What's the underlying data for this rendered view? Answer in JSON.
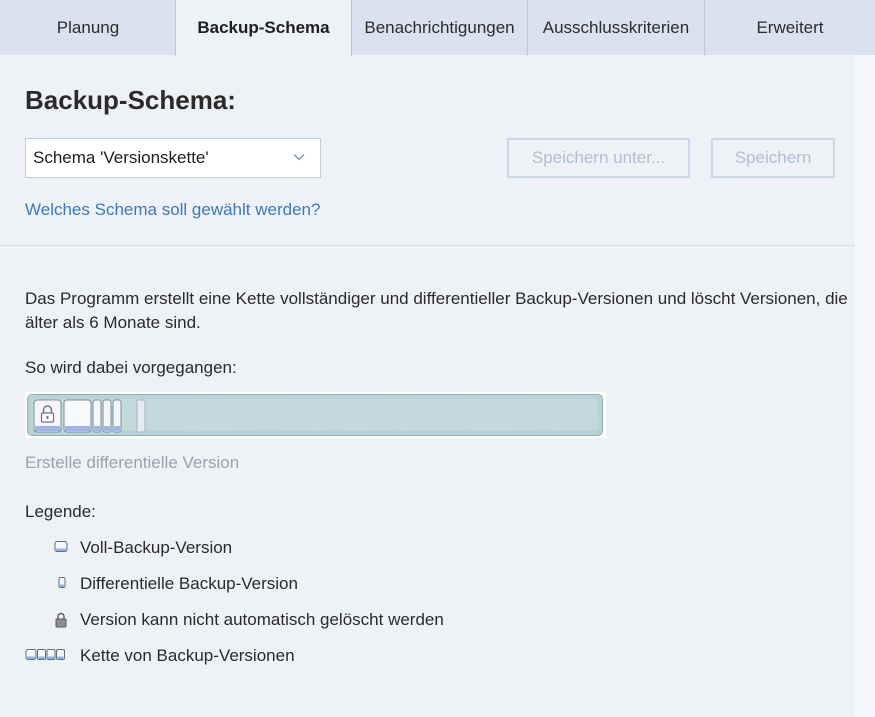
{
  "tabs": [
    {
      "label": "Planung",
      "active": false
    },
    {
      "label": "Backup-Schema",
      "active": true
    },
    {
      "label": "Benachrichtigungen",
      "active": false
    },
    {
      "label": "Ausschlusskriterien",
      "active": false
    },
    {
      "label": "Erweitert",
      "active": false
    }
  ],
  "main": {
    "title": "Backup-Schema:",
    "scheme_select": {
      "value": "Schema 'Versionskette'"
    },
    "save_as_label": "Speichern unter...",
    "save_label": "Speichern",
    "help_link": "Welches Schema soll gewählt werden?",
    "description": "Das Programm erstellt eine Kette vollständiger und differentieller Backup-Versionen und löscht Versionen, die älter als 6 Monate sind.",
    "how_label": "So wird dabei vorgegangen:",
    "chain_status": "Erstelle differentielle Version"
  },
  "legend": {
    "title": "Legende:",
    "items": [
      {
        "icon": "full-backup-icon",
        "label": "Voll-Backup-Version"
      },
      {
        "icon": "differential-backup-icon",
        "label": "Differentielle Backup-Version"
      },
      {
        "icon": "lock-icon",
        "label": "Version kann nicht automatisch gelöscht werden"
      },
      {
        "icon": "backup-chain-icon",
        "label": "Kette von Backup-Versionen"
      }
    ]
  },
  "colors": {
    "accent_link": "#3b79b8",
    "disabled_button_text": "#aebfd6",
    "chain_track": "#bfd7da"
  }
}
